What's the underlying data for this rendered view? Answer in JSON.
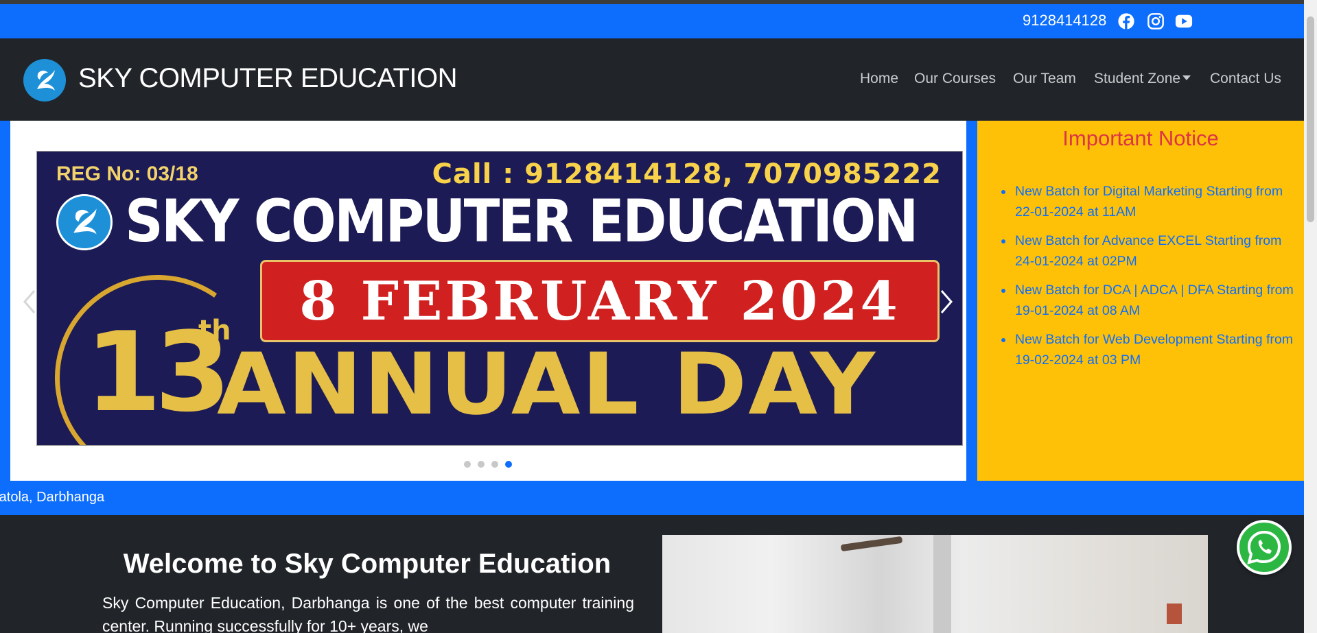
{
  "topbar": {
    "phone": "9128414128",
    "social_icons": [
      "facebook-icon",
      "instagram-icon",
      "youtube-icon"
    ]
  },
  "brand": {
    "name": "SKY COMPUTER EDUCATION",
    "logo_icon": "bird-logo"
  },
  "nav": {
    "items": [
      "Home",
      "Our Courses",
      "Our Team",
      "Student Zone",
      "Contact Us"
    ]
  },
  "banner": {
    "reg": "REG No: 03/18",
    "call": "Call : 9128414128, 7070985222",
    "title": "SKY COMPUTER EDUCATION",
    "date": "8 FEBRUARY 2024",
    "number": "13",
    "suffix": "th",
    "event": "ANNUAL DAY"
  },
  "carousel": {
    "slide_count": 4,
    "active_index": 3
  },
  "notice": {
    "title": "Important Notice",
    "items": [
      "New Batch for Digital Marketing Starting from 22-01-2024 at 11AM",
      "New Batch for Advance EXCEL Starting from 24-01-2024 at 02PM",
      "New Batch for DCA | ADCA | DFA Starting from 19-01-2024 at 08 AM",
      "New Batch for Web Development Starting from 19-02-2024 at 03 PM"
    ]
  },
  "ticker": {
    "text": "ratola, Darbhanga"
  },
  "welcome": {
    "title": "Welcome to Sky Computer Education",
    "text": "Sky Computer Education, Darbhanga is one of the best computer training center. Running successfully for 10+ years, we"
  },
  "colors": {
    "primary": "#0d6efd",
    "dark": "#212529",
    "notice_bg": "#ffc107",
    "notice_title": "#dc3545",
    "whatsapp": "#2cb742"
  }
}
